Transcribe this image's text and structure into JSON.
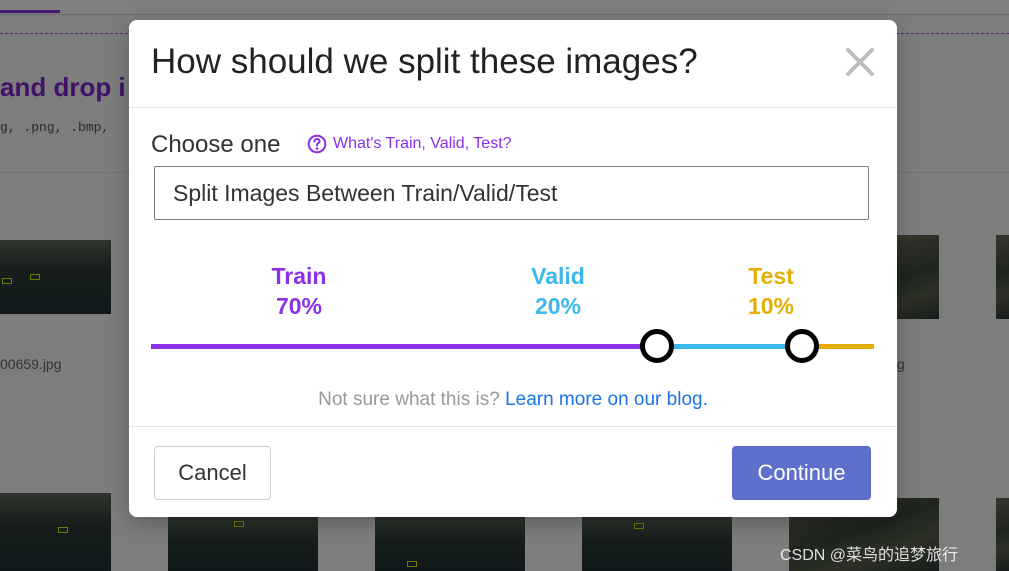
{
  "background": {
    "drop_title": "and drop i",
    "formats": "g, .png, .bmp,",
    "filenames": [
      "00659.jpg",
      "g"
    ],
    "watermark": "CSDN @菜鸟的追梦旅行"
  },
  "modal": {
    "title": "How should we split these images?",
    "close_icon": "close-icon",
    "choose_label": "Choose one",
    "help_icon": "question-circle-icon",
    "help_link": "What's Train, Valid, Test?",
    "select_value": "Split Images Between Train/Valid/Test",
    "split": {
      "train": {
        "label": "Train",
        "percent_text": "70%",
        "value": 70,
        "color": "#8b2fe8"
      },
      "valid": {
        "label": "Valid",
        "percent_text": "20%",
        "value": 20,
        "color": "#3cb8ec"
      },
      "test": {
        "label": "Test",
        "percent_text": "10%",
        "value": 10,
        "color": "#e6ae00"
      }
    },
    "learn_prefix": "Not sure what this is?",
    "learn_link": "Learn more on our blog.",
    "cancel_label": "Cancel",
    "continue_label": "Continue"
  },
  "colors": {
    "accent": "#8b2fe8",
    "link": "#1a73e8",
    "primary_button": "#5f6fcc"
  }
}
